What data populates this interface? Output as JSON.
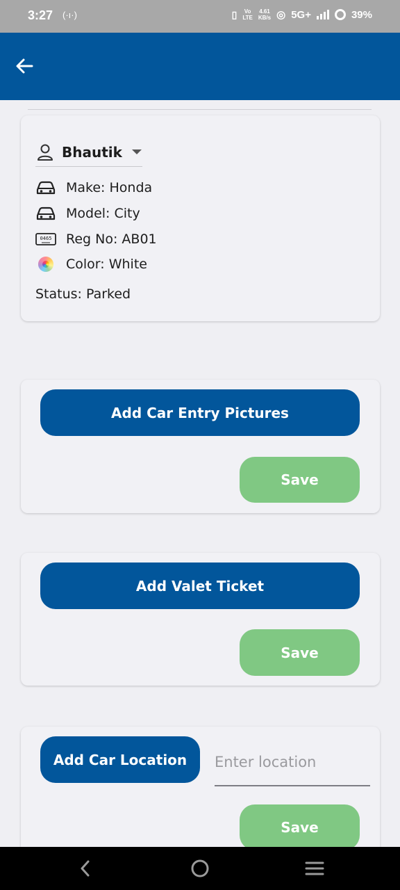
{
  "status_bar": {
    "time": "3:27",
    "speed_value": "4.61",
    "speed_unit": "KB/s",
    "network": "5G+",
    "battery": "39%"
  },
  "car": {
    "owner_name": "Bhautik",
    "make": "Make: Honda",
    "model": "Model: City",
    "reg_no": "Reg No: AB01",
    "color": "Color: White",
    "status": "Status: Parked",
    "plate_icon_text": "0465"
  },
  "entry_pictures": {
    "button_label": "Add Car Entry Pictures",
    "save_label": "Save"
  },
  "valet_ticket": {
    "button_label": "Add Valet Ticket",
    "save_label": "Save"
  },
  "car_location": {
    "button_label": "Add Car Location",
    "placeholder": "Enter location",
    "save_label": "Save"
  },
  "colors": {
    "primary": "#02569b",
    "save": "#80c883",
    "background": "#efeff3"
  }
}
